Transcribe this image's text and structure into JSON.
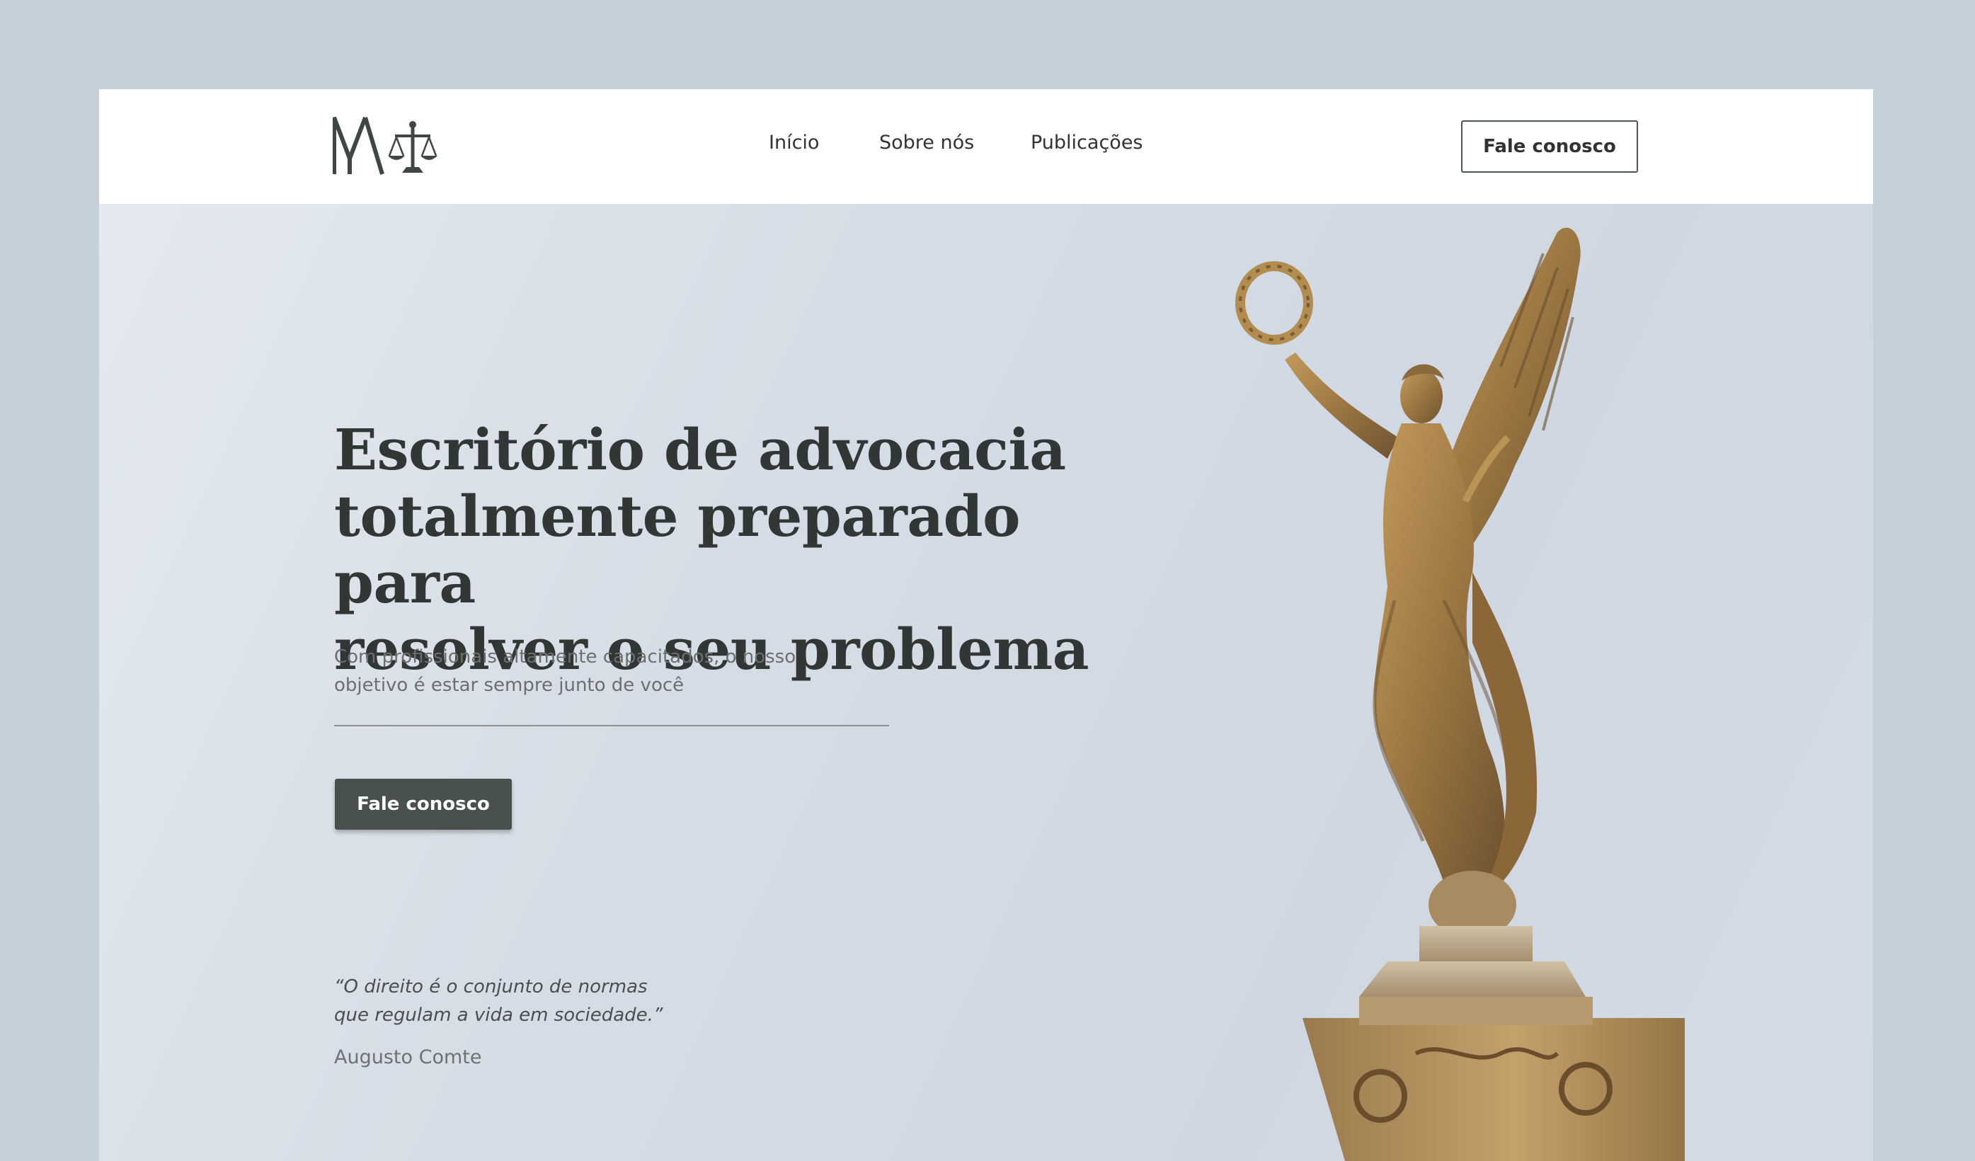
{
  "colors": {
    "page_background": "#c4d1db",
    "accent_dark_green": "#49514c",
    "text_dark": "#323634",
    "text_muted": "#6b6f70",
    "statue_bronze": "#a07a44"
  },
  "header": {
    "logo_icon": "ma-scales-of-justice-logo",
    "nav": [
      {
        "label": "Início"
      },
      {
        "label": "Sobre nós"
      },
      {
        "label": "Publicações"
      }
    ],
    "cta_label": "Fale conosco"
  },
  "hero": {
    "title_lines": [
      "Escritório de advocacia",
      "totalmente preparado para",
      "resolver o seu problema"
    ],
    "subtitle_lines": [
      "Com profissionais altamente capacitados, o nosso",
      "objetivo é estar sempre junto de você"
    ],
    "cta_label": "Fale conosco",
    "quote_lines": [
      "“O direito é o conjunto de normas",
      "que regulam a vida em sociedade.”"
    ],
    "quote_author": "Augusto Comte",
    "image": "winged-victory-statue-on-column"
  }
}
